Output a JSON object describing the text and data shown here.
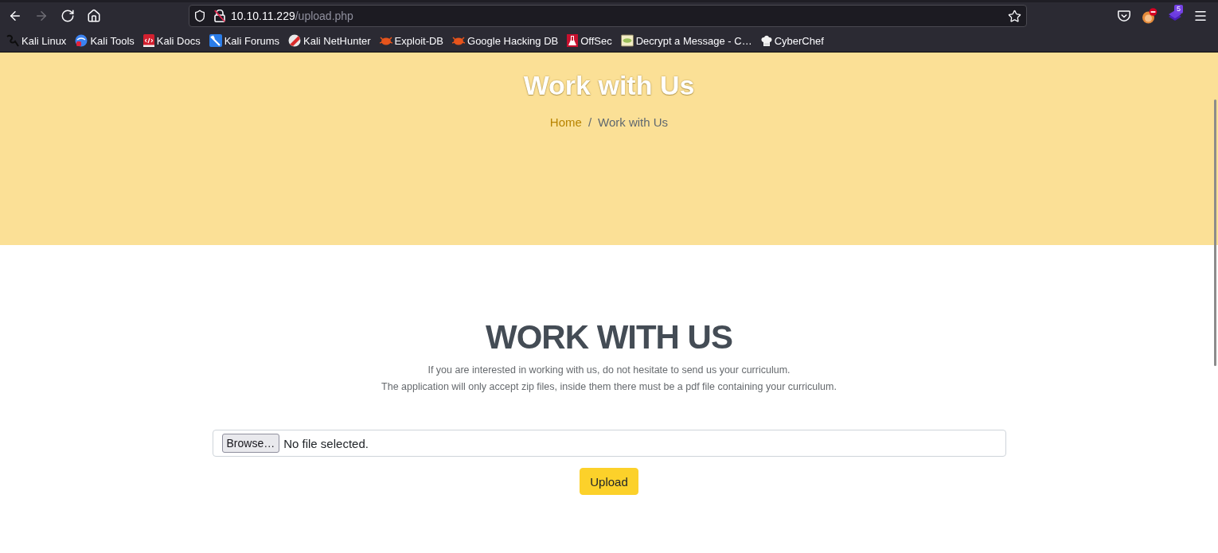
{
  "toolbar": {
    "nav": [
      {
        "kind": "back",
        "disabled": false
      },
      {
        "kind": "forward",
        "disabled": true
      },
      {
        "kind": "reload",
        "disabled": false
      },
      {
        "kind": "home",
        "disabled": false
      }
    ],
    "address": {
      "host": "10.10.11.229",
      "path": "/upload.php"
    },
    "extensions": [
      {
        "kind": "pocket"
      },
      {
        "kind": "fox"
      },
      {
        "kind": "stack",
        "badge": "5"
      }
    ]
  },
  "bookmarks": [
    "Kali Linux",
    "Kali Tools",
    "Kali Docs",
    "Kali Forums",
    "Kali NetHunter",
    "Exploit-DB",
    "Google Hacking DB",
    "OffSec",
    "Decrypt a Message - C…",
    "CyberChef"
  ],
  "hero": {
    "title": "Work with Us",
    "breadcrumb": [
      {
        "label": "Home",
        "kind": "link"
      },
      {
        "label": "Work with Us",
        "kind": "current"
      }
    ],
    "separator": "/"
  },
  "section": {
    "heading": "WORK WITH US",
    "lines": [
      "If you are interested in working with us, do not hesitate to send us your curriculum.",
      "The application will only accept zip files, inside them there must be a pdf file containing your curriculum."
    ],
    "file_input": {
      "button": "Browse…",
      "status": "No file selected."
    },
    "submit": "Upload"
  }
}
